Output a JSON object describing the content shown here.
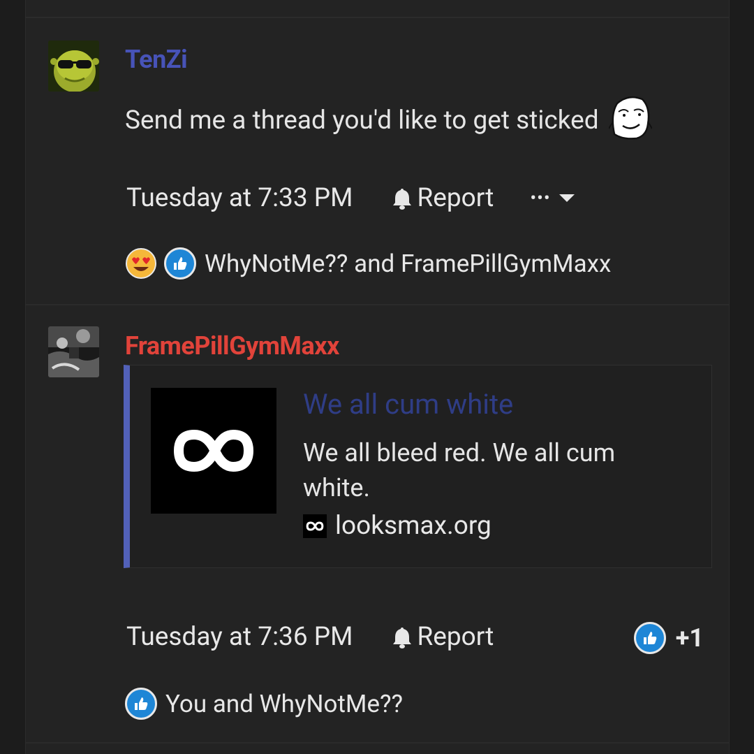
{
  "posts": [
    {
      "username": "TenZi",
      "username_color": "#4753b8",
      "message": "Send me a thread you'd like to get sticked",
      "timestamp": "Tuesday at 7:33 PM",
      "report_label": "Report",
      "more_label": "•••",
      "reactions_text": "WhyNotMe?? and FramePillGymMaxx",
      "avatar_icon": "shrek-sunglasses-avatar",
      "inline_icon": "wojak-meme-icon"
    },
    {
      "username": "FramePillGymMaxx",
      "username_color": "#e1433a",
      "embed": {
        "title": "We all cum white",
        "description": "We all bleed red. We all cum white.",
        "site": "looksmax.org",
        "logo_icon": "infinity-logo-icon"
      },
      "timestamp": "Tuesday at 7:36 PM",
      "report_label": "Report",
      "like_count": "+1",
      "reactions_text": "You and WhyNotMe??",
      "avatar_icon": "grayscale-photo-avatar"
    }
  ],
  "colors": {
    "background": "#232323",
    "accent_bar": "#5261b9",
    "like_blue": "#1e86d6",
    "embed_title": "#2f3d86"
  }
}
